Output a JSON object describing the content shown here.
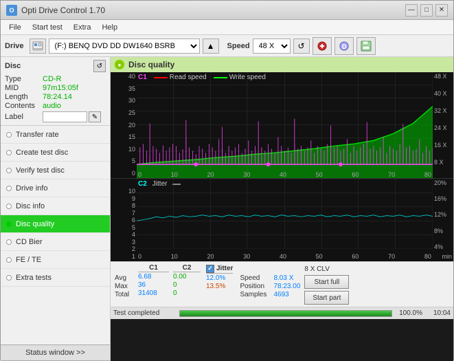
{
  "window": {
    "title": "Opti Drive Control 1.70",
    "icon": "O",
    "controls": {
      "minimize": "—",
      "maximize": "□",
      "close": "✕"
    }
  },
  "menu": {
    "items": [
      "File",
      "Start test",
      "Extra",
      "Help"
    ]
  },
  "drive_bar": {
    "label": "Drive",
    "drive_value": "(F:)  BENQ DVD DD DW1640 BSRB",
    "speed_label": "Speed",
    "speed_value": "48 X",
    "eject_icon": "▲"
  },
  "disc": {
    "title": "Disc",
    "type_label": "Type",
    "type_value": "CD-R",
    "mid_label": "MID",
    "mid_value": "97m15:05f",
    "length_label": "Length",
    "length_value": "78:24.14",
    "contents_label": "Contents",
    "contents_value": "audio",
    "label_label": "Label",
    "label_value": ""
  },
  "nav_items": [
    {
      "id": "transfer-rate",
      "label": "Transfer rate",
      "active": false
    },
    {
      "id": "create-test-disc",
      "label": "Create test disc",
      "active": false
    },
    {
      "id": "verify-test-disc",
      "label": "Verify test disc",
      "active": false
    },
    {
      "id": "drive-info",
      "label": "Drive info",
      "active": false
    },
    {
      "id": "disc-info",
      "label": "Disc info",
      "active": false
    },
    {
      "id": "disc-quality",
      "label": "Disc quality",
      "active": true
    },
    {
      "id": "cd-bier",
      "label": "CD Bier",
      "active": false
    },
    {
      "id": "fe-te",
      "label": "FE / TE",
      "active": false
    },
    {
      "id": "extra-tests",
      "label": "Extra tests",
      "active": false
    }
  ],
  "status_btn": "Status window >>",
  "chart": {
    "title": "Disc quality",
    "legend": {
      "c1_label": "C1",
      "read_label": "Read speed",
      "write_label": "Write speed"
    },
    "top": {
      "y_labels_left": [
        "40",
        "35",
        "30",
        "25",
        "20",
        "15",
        "10",
        "5",
        "0"
      ],
      "y_labels_right": [
        "48 X",
        "40 X",
        "32 X",
        "24 X",
        "16 X",
        "8 X"
      ],
      "x_labels": [
        "0",
        "10",
        "20",
        "30",
        "40",
        "50",
        "60",
        "70",
        "80"
      ]
    },
    "bottom": {
      "label": "C2",
      "jitter_label": "Jitter",
      "y_labels_left": [
        "10",
        "9",
        "8",
        "7",
        "6",
        "5",
        "4",
        "3",
        "2",
        "1"
      ],
      "y_labels_right": [
        "20%",
        "16%",
        "12%",
        "8%",
        "4%"
      ],
      "x_labels": [
        "0",
        "10",
        "20",
        "30",
        "40",
        "50",
        "60",
        "70",
        "80"
      ],
      "min_label": "min"
    }
  },
  "stats": {
    "c1_header": "C1",
    "c2_header": "C2",
    "jitter_header": "Jitter",
    "avg_label": "Avg",
    "max_label": "Max",
    "total_label": "Total",
    "c1_avg": "6.68",
    "c1_max": "36",
    "c1_total": "31408",
    "c2_avg": "0.00",
    "c2_max": "0",
    "c2_total": "0",
    "jitter_avg": "12.0%",
    "jitter_max": "13.5%",
    "speed_label": "Speed",
    "speed_value": "8.03 X",
    "position_label": "Position",
    "position_value": "78:23.00",
    "samples_label": "Samples",
    "samples_value": "4693",
    "clv_value": "8 X CLV",
    "start_full": "Start full",
    "start_part": "Start part"
  },
  "progress": {
    "status_text": "Test completed",
    "percent": "100.0%",
    "time": "10:04"
  }
}
